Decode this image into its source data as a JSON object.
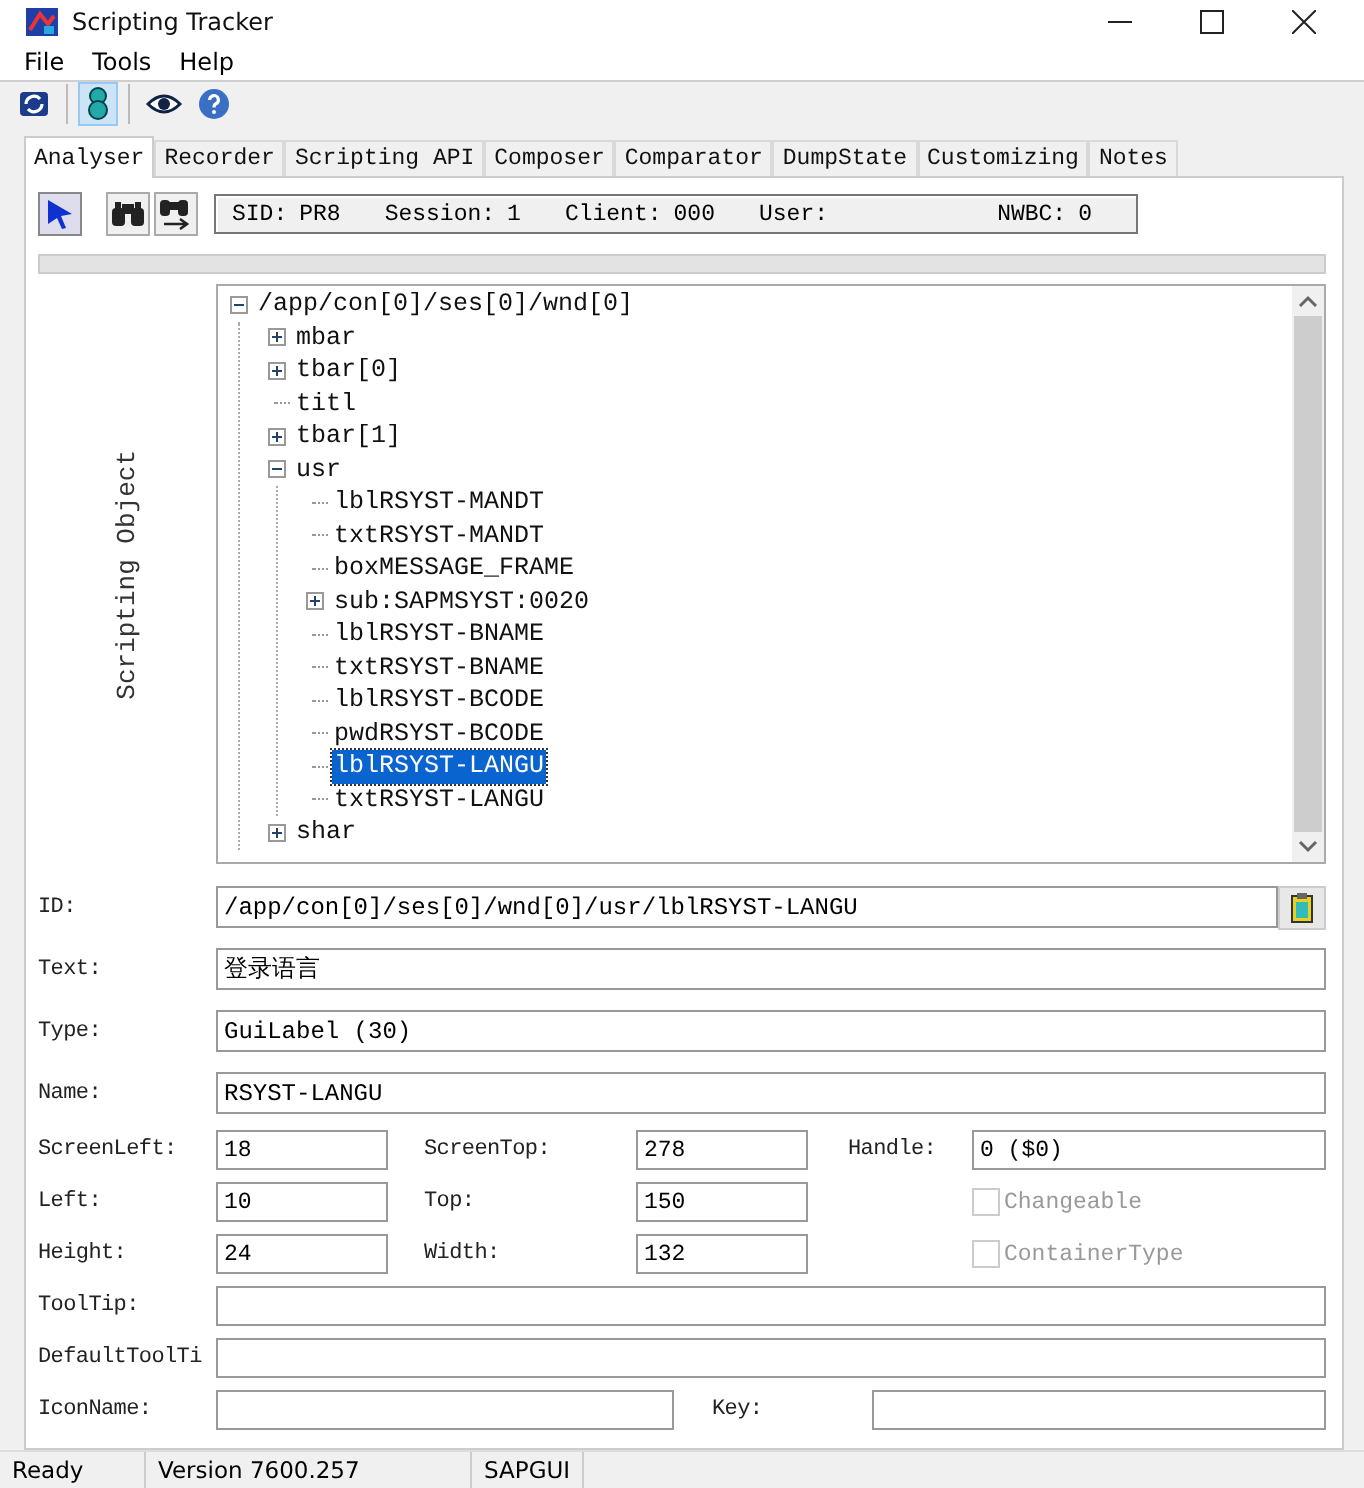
{
  "window": {
    "title": "Scripting Tracker"
  },
  "menu": [
    "File",
    "Tools",
    "Help"
  ],
  "toolbar": [
    {
      "kind": "refresh",
      "selected": false
    },
    {
      "kind": "pin",
      "selected": true
    },
    {
      "kind": "eye",
      "selected": false
    },
    {
      "kind": "help",
      "selected": false
    }
  ],
  "tabs": [
    {
      "label": "Analyser",
      "selected": true
    },
    {
      "label": "Recorder",
      "selected": false
    },
    {
      "label": "Scripting API",
      "selected": false
    },
    {
      "label": "Composer",
      "selected": false
    },
    {
      "label": "Comparator",
      "selected": false
    },
    {
      "label": "DumpState",
      "selected": false
    },
    {
      "label": "Customizing",
      "selected": false
    },
    {
      "label": "Notes",
      "selected": false
    }
  ],
  "analyser_tools": [
    {
      "kind": "pointer",
      "selected": true
    },
    {
      "kind": "binoculars",
      "selected": false
    },
    {
      "kind": "binoculars-next",
      "selected": false
    }
  ],
  "session_info": [
    {
      "label": "SID:",
      "value": "PR8"
    },
    {
      "label": "Session:",
      "value": "1"
    },
    {
      "label": "Client:",
      "value": "000"
    },
    {
      "label": "User:"
    },
    {
      "label": "NWBC:",
      "value": "0"
    }
  ],
  "tree_caption": "Scripting Object",
  "tree": [
    {
      "label": "/app/con[0]/ses[0]/wnd[0]",
      "expanded": true,
      "selected": false,
      "children": [
        {
          "label": "mbar",
          "expanded": false,
          "selected": false
        },
        {
          "label": "tbar[0]",
          "expanded": false,
          "selected": false
        },
        {
          "label": "titl",
          "selected": false
        },
        {
          "label": "tbar[1]",
          "expanded": false,
          "selected": false
        },
        {
          "label": "usr",
          "expanded": true,
          "selected": false,
          "children": [
            {
              "label": "lblRSYST-MANDT",
              "selected": false
            },
            {
              "label": "txtRSYST-MANDT",
              "selected": false
            },
            {
              "label": "boxMESSAGE_FRAME",
              "selected": false
            },
            {
              "label": "sub:SAPMSYST:0020",
              "expanded": false,
              "selected": false
            },
            {
              "label": "lblRSYST-BNAME",
              "selected": false
            },
            {
              "label": "txtRSYST-BNAME",
              "selected": false
            },
            {
              "label": "lblRSYST-BCODE",
              "selected": false
            },
            {
              "label": "pwdRSYST-BCODE",
              "selected": false
            },
            {
              "label": "lblRSYST-LANGU",
              "selected": true
            },
            {
              "label": "txtRSYST-LANGU",
              "selected": false
            }
          ]
        },
        {
          "label": "shar",
          "expanded": false,
          "selected": false
        }
      ]
    }
  ],
  "properties": [
    {
      "kind": "wide",
      "label": "ID:",
      "value": "/app/con[0]/ses[0]/wnd[0]/usr/lblRSYST-LANGU",
      "copy": true
    },
    {
      "kind": "wide",
      "label": "Text:",
      "value": "登录语言"
    },
    {
      "kind": "wide",
      "label": "Type:",
      "value": "GuiLabel (30)"
    },
    {
      "kind": "wide",
      "label": "Name:",
      "value": "RSYST-LANGU"
    },
    {
      "kind": "triple",
      "cells": [
        {
          "kind": "field",
          "label": "ScreenLeft:",
          "value": "18"
        },
        {
          "kind": "field",
          "label": "ScreenTop:",
          "value": "278"
        },
        {
          "kind": "field",
          "label": "Handle:",
          "value": "0 ($0)"
        }
      ]
    },
    {
      "kind": "triple",
      "cells": [
        {
          "kind": "field",
          "label": "Left:",
          "value": "10"
        },
        {
          "kind": "field",
          "label": "Top:",
          "value": "150"
        },
        {
          "kind": "checkbox",
          "label": "Changeable",
          "checked": false,
          "disabled": true
        }
      ]
    },
    {
      "kind": "triple",
      "cells": [
        {
          "kind": "field",
          "label": "Height:",
          "value": "24"
        },
        {
          "kind": "field",
          "label": "Width:",
          "value": "132"
        },
        {
          "kind": "checkbox",
          "label": "ContainerType",
          "checked": false,
          "disabled": true
        }
      ]
    },
    {
      "kind": "compact",
      "label": "ToolTip:"
    },
    {
      "kind": "compact",
      "label": "DefaultToolTi"
    },
    {
      "kind": "pair",
      "cells": [
        {
          "label": "IconName:"
        },
        {
          "label": "Key:"
        }
      ]
    }
  ],
  "status_bar": [
    "Ready",
    "Version 7600.257",
    "SAPGUI"
  ]
}
